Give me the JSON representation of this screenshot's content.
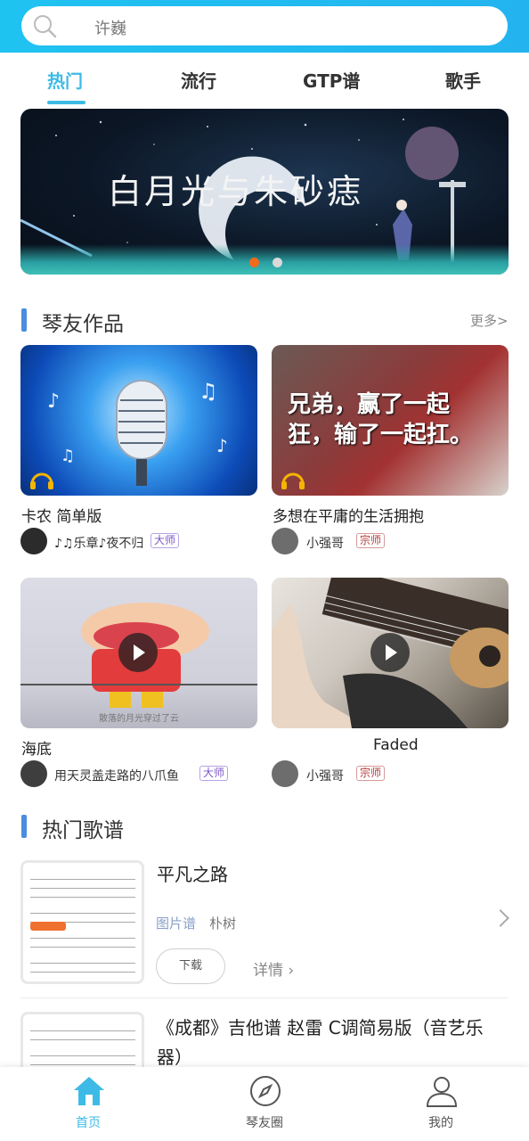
{
  "search": {
    "placeholder": "许巍",
    "icon": "search-icon"
  },
  "tabs": [
    {
      "label": "热门",
      "active": true
    },
    {
      "label": "流行",
      "active": false
    },
    {
      "label": "GTP谱",
      "active": false
    },
    {
      "label": "歌手",
      "active": false
    }
  ],
  "banner": {
    "title": "白月光与朱砂痣",
    "page_count": 2,
    "current_page": 1
  },
  "friends_works": {
    "title": "琴友作品",
    "more": "更多>",
    "items": [
      {
        "title": "卡农 简单版",
        "user": "♪♫乐章♪夜不归",
        "badge": "大师",
        "type": "audio"
      },
      {
        "title": "多想在平庸的生活拥抱",
        "user": "小强哥",
        "badge": "宗师",
        "type": "audio"
      },
      {
        "title": "海底",
        "user": "用天灵盖走路的八爪鱼",
        "badge": "大师",
        "type": "video"
      },
      {
        "title": "Faded",
        "user": "小强哥",
        "badge": "宗师",
        "type": "video"
      }
    ],
    "image_texts": {
      "item2": "兄弟，赢了一起狂，输了一起扛。",
      "item3": "散落的月光穿过了云"
    }
  },
  "hot_tabs": {
    "title": "热门歌谱",
    "items": [
      {
        "title": "平凡之路",
        "type": "图片谱",
        "artist": "朴树",
        "download": "下载",
        "detail": "详情"
      },
      {
        "title": "《成都》吉他谱 赵雷 C调简易版（音艺乐器）"
      }
    ]
  },
  "bottom_nav": [
    {
      "label": "首页",
      "icon": "home-icon",
      "active": true
    },
    {
      "label": "琴友圈",
      "icon": "compass-icon",
      "active": false
    },
    {
      "label": "我的",
      "icon": "user-icon",
      "active": false
    }
  ],
  "colors": {
    "accent": "#3dbbe6",
    "header": "#1fc3f0",
    "section_bar": "#4a8de0"
  }
}
